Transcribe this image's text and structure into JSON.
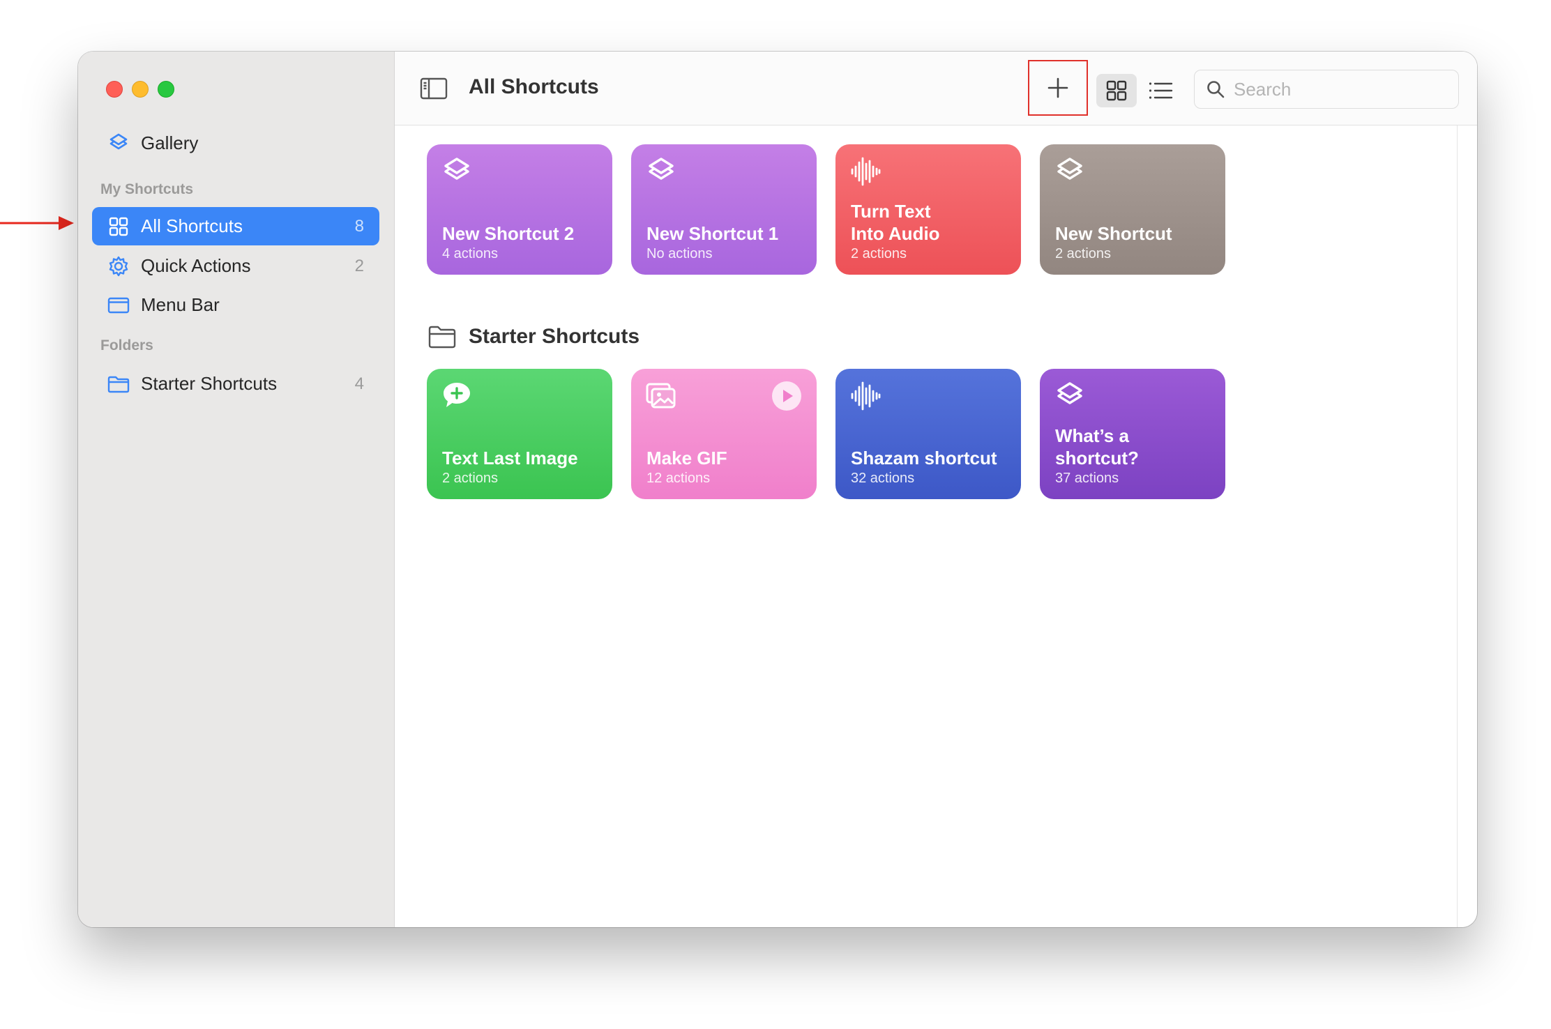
{
  "sidebar": {
    "gallery_label": "Gallery",
    "section_my_shortcuts": "My Shortcuts",
    "items": [
      {
        "label": "All Shortcuts",
        "count": "8"
      },
      {
        "label": "Quick Actions",
        "count": "2"
      },
      {
        "label": "Menu Bar",
        "count": ""
      }
    ],
    "section_folders": "Folders",
    "folders": [
      {
        "label": "Starter Shortcuts",
        "count": "4"
      }
    ]
  },
  "toolbar": {
    "title": "All Shortcuts",
    "search_placeholder": "Search"
  },
  "shortcuts": [
    {
      "title": "New Shortcut 2",
      "subtitle": "4 actions",
      "icon": "layers-icon",
      "color_top": "#c47fe6",
      "color_bottom": "#a866de"
    },
    {
      "title": "New Shortcut 1",
      "subtitle": "No actions",
      "icon": "layers-icon",
      "color_top": "#c47fe6",
      "color_bottom": "#a866de"
    },
    {
      "title": "Turn Text Into Audio",
      "subtitle": "2 actions",
      "icon": "waveform-icon",
      "color_top": "#f77277",
      "color_bottom": "#ed5157"
    },
    {
      "title": "New Shortcut",
      "subtitle": "2 actions",
      "icon": "layers-icon",
      "color_top": "#aa9e98",
      "color_bottom": "#928680"
    }
  ],
  "starter_folder": {
    "title": "Starter Shortcuts",
    "shortcuts": [
      {
        "title": "Text Last Image",
        "subtitle": "2 actions",
        "icon": "message-plus-icon",
        "color_top": "#5bd773",
        "color_bottom": "#3bc451"
      },
      {
        "title": "Make GIF",
        "subtitle": "12 actions",
        "icon": "photos-icon",
        "color_top": "#f8a0d8",
        "color_bottom": "#f07fcb"
      },
      {
        "title": "Shazam shortcut",
        "subtitle": "32 actions",
        "icon": "waveform-icon",
        "color_top": "#5573db",
        "color_bottom": "#3d58c7"
      },
      {
        "title": "What’s a shortcut?",
        "subtitle": "37 actions",
        "icon": "layers-icon",
        "color_top": "#9b5ad6",
        "color_bottom": "#7c42c2"
      }
    ]
  },
  "colors": {
    "accent": "#3b86f7",
    "highlight_box": "#e0302a",
    "annotation_arrow": "#e8281e"
  }
}
